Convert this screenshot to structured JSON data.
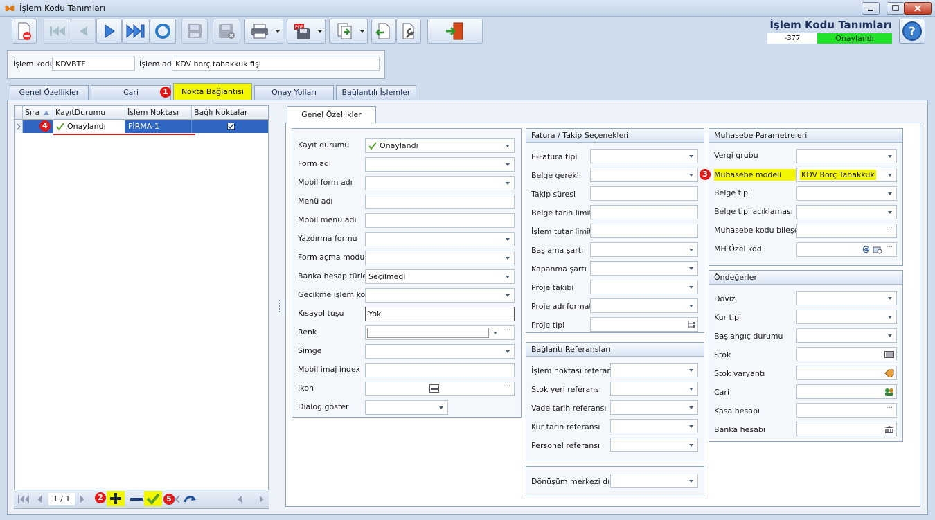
{
  "window": {
    "title": "İşlem Kodu Tanımları"
  },
  "header": {
    "app_title": "İşlem Kodu Tanımları",
    "record_code": "-377",
    "record_status": "Onaylandı",
    "status_color": "#22e22a"
  },
  "form": {
    "islem_kodu_label": "İşlem kodu",
    "islem_kodu_value": "KDVBTF",
    "islem_adi_label": "İşlem adı",
    "islem_adi_value": "KDV borç tahakkuk fişi"
  },
  "tabs": [
    {
      "label": "Genel Özellikler"
    },
    {
      "label": "Cari"
    },
    {
      "label": "Nokta Bağlantısı"
    },
    {
      "label": "Onay Yolları"
    },
    {
      "label": "Bağlantılı İşlemler"
    }
  ],
  "grid": {
    "columns": [
      "Sıra",
      "KayıtDurumu",
      "İşlem Noktası",
      "Bağlı Noktalar"
    ],
    "rows": [
      {
        "status": "Onaylandı",
        "point": "FİRMA-1",
        "linked": true
      }
    ],
    "pager": "1 / 1"
  },
  "inner_tab": "Genel Özellikler",
  "general": {
    "fields": [
      {
        "label": "Kayıt durumu",
        "value": "Onaylandı"
      },
      {
        "label": "Form adı",
        "value": ""
      },
      {
        "label": "Mobil form adı",
        "value": ""
      },
      {
        "label": "Menü adı",
        "value": ""
      },
      {
        "label": "Mobil menü adı",
        "value": ""
      },
      {
        "label": "Yazdırma formu",
        "value": ""
      },
      {
        "label": "Form açma modu",
        "value": ""
      },
      {
        "label": "Banka hesap türleri",
        "value": "Seçilmedi"
      },
      {
        "label": "Gecikme işlem kodu",
        "value": ""
      },
      {
        "label": "Kısayol tuşu",
        "value": "Yok"
      },
      {
        "label": "Renk",
        "value": ""
      },
      {
        "label": "Simge",
        "value": ""
      },
      {
        "label": "Mobil imaj index",
        "value": ""
      },
      {
        "label": "İkon",
        "value": ""
      },
      {
        "label": "Dialog göster",
        "value": ""
      }
    ]
  },
  "fatura": {
    "title": "Fatura / Takip Seçenekleri",
    "fields": [
      "E-Fatura tipi",
      "Belge gerekli",
      "Takip süresi",
      "Belge tarih limiti",
      "İşlem tutar limiti",
      "Başlama şartı",
      "Kapanma şartı",
      "Proje takibi",
      "Proje adı formatı",
      "Proje tipi"
    ]
  },
  "baglanti": {
    "title": "Bağlantı Referansları",
    "fields": [
      "İşlem noktası referansı",
      "Stok yeri referansı",
      "Vade tarih referansı",
      "Kur tarih referansı",
      "Personel referansı"
    ]
  },
  "donusum": {
    "label": "Dönüşüm merkezi dışı"
  },
  "muhasebe": {
    "title": "Muhasebe Parametreleri",
    "fields": [
      {
        "label": "Vergi grubu",
        "value": ""
      },
      {
        "label": "Muhasebe modeli",
        "value": "KDV Borç Tahakkuk"
      },
      {
        "label": "Belge tipi",
        "value": ""
      },
      {
        "label": "Belge tipi açıklaması",
        "value": ""
      },
      {
        "label": "Muhasebe kodu bileşeni",
        "value": ""
      },
      {
        "label": "MH Özel kod",
        "value": ""
      }
    ]
  },
  "ondegerler": {
    "title": "Öndeğerler",
    "fields": [
      "Döviz",
      "Kur tipi",
      "Başlangıç durumu",
      "Stok",
      "Stok varyantı",
      "Cari",
      "Kasa hesabı",
      "Banka hesabı"
    ]
  },
  "markers": [
    "1",
    "2",
    "3",
    "4",
    "5"
  ],
  "icons": [
    "butterfly-icon",
    "new-record-icon",
    "first-icon",
    "prev-icon",
    "next-icon",
    "last-icon",
    "refresh-icon",
    "save-icon",
    "save-cancel-icon",
    "print-icon",
    "pdf-icon",
    "export-icon",
    "import-icon",
    "tools-icon",
    "exit-icon",
    "help-icon"
  ]
}
